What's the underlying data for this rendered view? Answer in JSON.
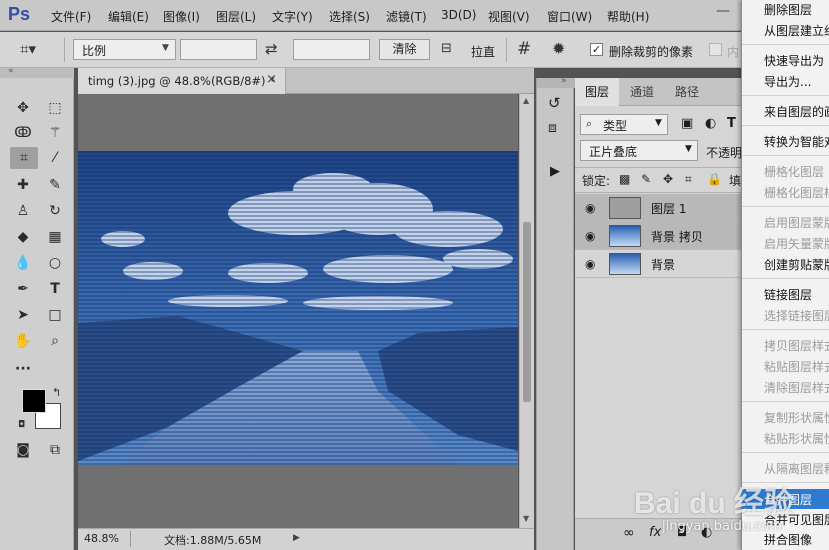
{
  "app": {
    "logo": "Ps"
  },
  "menu": [
    "文件(F)",
    "编辑(E)",
    "图像(I)",
    "图层(L)",
    "文字(Y)",
    "选择(S)",
    "滤镜(T)",
    "3D(D)",
    "视图(V)",
    "窗口(W)",
    "帮助(H)"
  ],
  "options": {
    "ratio_value": "比例",
    "clear_label": "清除",
    "straighten_label": "拉直",
    "delete_cropped_label": "删除裁剪的像素",
    "content_label": "内",
    "delete_cropped_checked": true
  },
  "document": {
    "tab_title": "timg (3).jpg @ 48.8%(RGB/8#) *",
    "close_glyph": "×"
  },
  "status": {
    "zoom": "48.8%",
    "doc_info": "文档:1.88M/5.65M"
  },
  "layers_panel": {
    "tabs": [
      "图层",
      "通道",
      "路径"
    ],
    "filter_kind": "类型",
    "blend_mode": "正片叠底",
    "opacity_label": "不透明",
    "lock_label": "锁定:",
    "fill_label": "填",
    "layers": [
      {
        "name": "图层 1",
        "selected": true,
        "thumb": "gray"
      },
      {
        "name": "背景 拷贝",
        "selected": true,
        "thumb": "image"
      },
      {
        "name": "背景",
        "selected": false,
        "thumb": "image"
      }
    ],
    "footer_icons": [
      "link-icon",
      "fx-icon"
    ]
  },
  "context_menu": {
    "items": [
      {
        "label": "删除图层",
        "disabled": false
      },
      {
        "label": "从图层建立组",
        "disabled": false
      },
      {
        "label": "快速导出为 P",
        "disabled": false
      },
      {
        "label": "导出为...",
        "disabled": false
      },
      {
        "label": "来自图层的画",
        "disabled": false
      },
      {
        "label": "转换为智能对",
        "disabled": false
      },
      {
        "label": "栅格化图层",
        "disabled": true
      },
      {
        "label": "栅格化图层样",
        "disabled": true
      },
      {
        "label": "启用图层蒙版",
        "disabled": true
      },
      {
        "label": "启用矢量蒙版",
        "disabled": true
      },
      {
        "label": "创建剪贴蒙版",
        "disabled": false
      },
      {
        "label": "链接图层",
        "disabled": false
      },
      {
        "label": "选择链接图层",
        "disabled": true
      },
      {
        "label": "拷贝图层样式",
        "disabled": true
      },
      {
        "label": "粘贴图层样式",
        "disabled": true
      },
      {
        "label": "清除图层样式",
        "disabled": true
      },
      {
        "label": "复制形状属性",
        "disabled": true
      },
      {
        "label": "粘贴形状属性",
        "disabled": true
      },
      {
        "label": "从隔离图层释",
        "disabled": true
      },
      {
        "label": "合并图层",
        "disabled": false,
        "highlighted": true
      },
      {
        "label": "合并可见图层",
        "disabled": false
      },
      {
        "label": "拼合图像",
        "disabled": false
      }
    ]
  },
  "watermark": {
    "text": "Bai du 经验",
    "url": "jingyan.baidu.com"
  },
  "colors": {
    "accent": "#2e7ad1",
    "image_tint": "#2c5596"
  }
}
